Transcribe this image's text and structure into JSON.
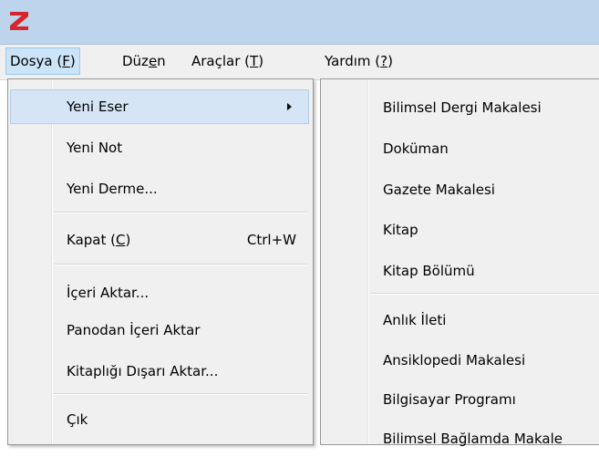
{
  "app": {
    "logo_letter": "Z",
    "logo_color": "#d4262b"
  },
  "menubar": {
    "items": [
      {
        "text": "Dosya (",
        "key": "F",
        "after": ")"
      },
      {
        "text": "Düz",
        "key": "e",
        "after": "n"
      },
      {
        "text": "Araçlar (",
        "key": "T",
        "after": ")"
      },
      {
        "text": "Yardım (",
        "key": "?",
        "after": ")"
      }
    ]
  },
  "file_menu": {
    "new_item": "Yeni Eser",
    "new_note": "Yeni Not",
    "new_collection": "Yeni Derme...",
    "close_pre": "Kapat (",
    "close_key": "C",
    "close_post": ")",
    "close_shortcut": "Ctrl+W",
    "import": "İçeri Aktar...",
    "import_clipboard": "Panodan İçeri Aktar",
    "export_library": "Kitaplığı Dışarı Aktar...",
    "quit": "Çık"
  },
  "new_item_submenu": {
    "items": [
      "Bilimsel Dergi Makalesi",
      "Doküman",
      "Gazete Makalesi",
      "Kitap",
      "Kitap Bölümü",
      "Anlık İleti",
      "Ansiklopedi Makalesi",
      "Bilgisayar Programı",
      "Bilimsel Bağlamda Makale"
    ]
  }
}
